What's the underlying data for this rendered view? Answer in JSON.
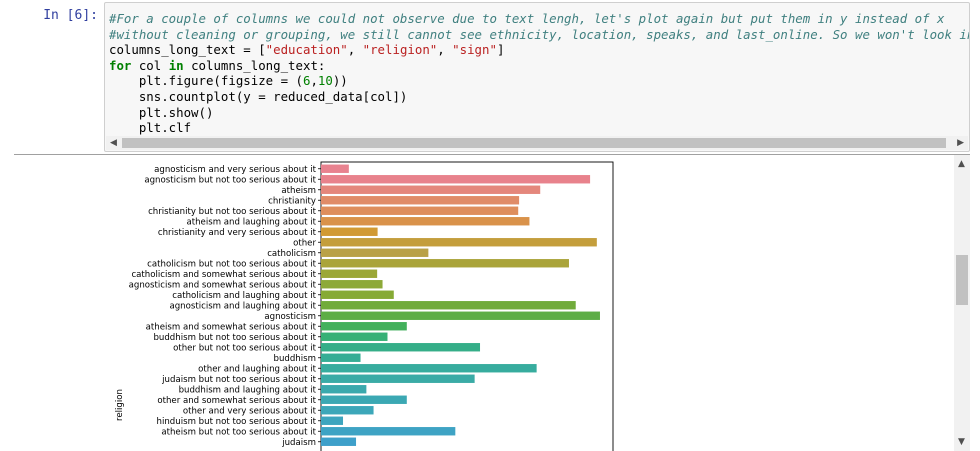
{
  "cell": {
    "prompt": "In [6]:",
    "code_lines": [
      [
        {
          "t": "#For a couple of columns we could not observe due to text lengh, let's plot again but put them in y instead of x",
          "c": "cm"
        }
      ],
      [
        {
          "t": "#without cleaning or grouping, we still cannot see ethnicity, location, speaks, and last_online. So we won't look into them yet.",
          "c": "cm"
        }
      ],
      [
        {
          "t": "columns_long_text = [",
          "c": ""
        },
        {
          "t": "\"education\"",
          "c": "st"
        },
        {
          "t": ", ",
          "c": ""
        },
        {
          "t": "\"religion\"",
          "c": "st"
        },
        {
          "t": ", ",
          "c": ""
        },
        {
          "t": "\"sign\"",
          "c": "st"
        },
        {
          "t": "]",
          "c": ""
        }
      ],
      [
        {
          "t": "for",
          "c": "kw"
        },
        {
          "t": " col ",
          "c": ""
        },
        {
          "t": "in",
          "c": "kw"
        },
        {
          "t": " columns_long_text:",
          "c": ""
        }
      ],
      [
        {
          "t": "    plt.figure(figsize = (",
          "c": ""
        },
        {
          "t": "6",
          "c": "nu"
        },
        {
          "t": ",",
          "c": ""
        },
        {
          "t": "10",
          "c": "nu"
        },
        {
          "t": "))",
          "c": ""
        }
      ],
      [
        {
          "t": "    sns.countplot(y = reduced_data[col])",
          "c": ""
        }
      ],
      [
        {
          "t": "    plt.show()",
          "c": ""
        }
      ],
      [
        {
          "t": "    plt.clf",
          "c": ""
        }
      ]
    ]
  },
  "chart_data": {
    "type": "bar",
    "orientation": "horizontal",
    "ylabel": "religion",
    "categories": [
      "agnosticism and very serious about it",
      "agnosticism but not too serious about it",
      "atheism",
      "christianity",
      "christianity but not too serious about it",
      "atheism and laughing about it",
      "christianity and very serious about it",
      "other",
      "catholicism",
      "catholicism but not too serious about it",
      "catholicism and somewhat serious about it",
      "agnosticism and somewhat serious about it",
      "catholicism and laughing about it",
      "agnosticism and laughing about it",
      "agnosticism",
      "atheism and somewhat serious about it",
      "buddhism but not too serious about it",
      "other but not too serious about it",
      "buddhism",
      "other and laughing about it",
      "judaism but not too serious about it",
      "buddhism and laughing about it",
      "other and somewhat serious about it",
      "other and very serious about it",
      "hinduism but not too serious about it",
      "atheism but not too serious about it",
      "judaism"
    ],
    "values": [
      620,
      5990,
      4880,
      4410,
      4390,
      4640,
      1260,
      6140,
      2390,
      5520,
      1250,
      1370,
      1620,
      5670,
      6210,
      1910,
      1480,
      3540,
      880,
      4800,
      3420,
      1010,
      1910,
      1170,
      490,
      2990,
      780
    ],
    "colors": [
      "#e8828f",
      "#e8828c",
      "#e4877c",
      "#e08c68",
      "#de8e5c",
      "#d9924a",
      "#d19a34",
      "#c49e3c",
      "#b9a147",
      "#aaa43a",
      "#9ba737",
      "#8da938",
      "#86aa35",
      "#71ab3b",
      "#5dad46",
      "#43b05c",
      "#36b076",
      "#35ae88",
      "#36ad95",
      "#37ac9e",
      "#3aaba6",
      "#3aa9ad",
      "#3ba8b3",
      "#3ca7b9",
      "#3da5be",
      "#3ea3c4",
      "#3ea0ca"
    ],
    "xlim": [
      0,
      6500
    ],
    "legend": "none"
  }
}
